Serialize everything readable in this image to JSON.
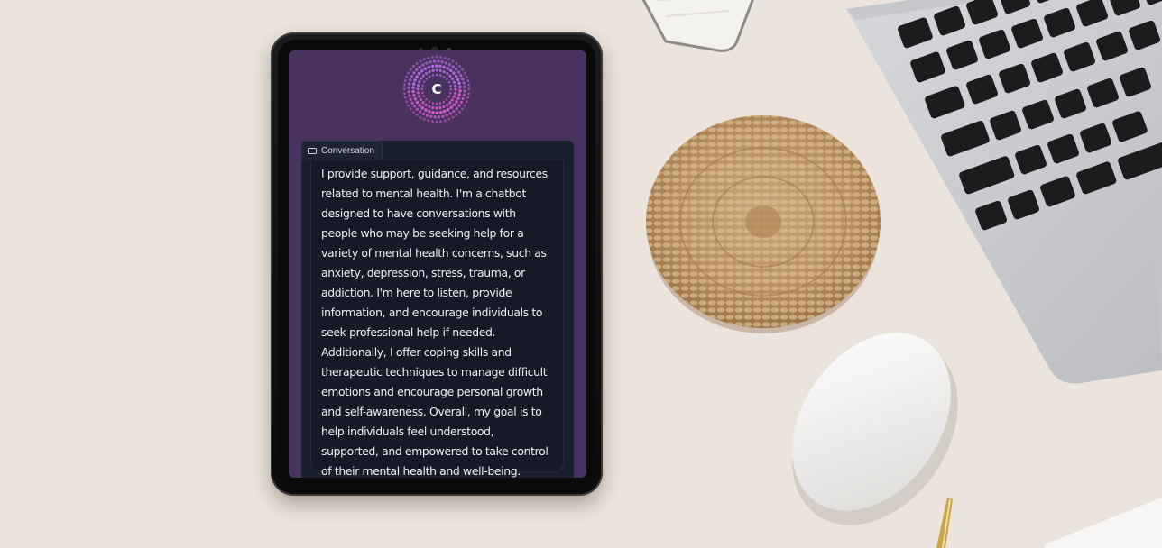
{
  "app": {
    "logo_letter": "C"
  },
  "conversation": {
    "tab_label": "Conversation",
    "tab_icon": "chat-bubble-icon",
    "message": "I provide support, guidance, and resources related to mental health. I'm a chatbot designed to have conversations with people who may be seeking help for a variety of mental health concerns, such as anxiety, depression, stress, trauma, or addiction. I'm here to listen, provide information, and encourage individuals to seek professional help if needed. Additionally, I offer coping skills and therapeutic techniques to manage difficult emotions and encourage personal growth and self-awareness. Overall, my goal is to help individuals feel understood, supported, and empowered to take control of their mental health and well-being."
  },
  "colors": {
    "desk": "#ebe4dc",
    "screen_bg": "#47335d",
    "panel_bg": "#1a1f2c",
    "logo_dots": "#d85ad0"
  }
}
